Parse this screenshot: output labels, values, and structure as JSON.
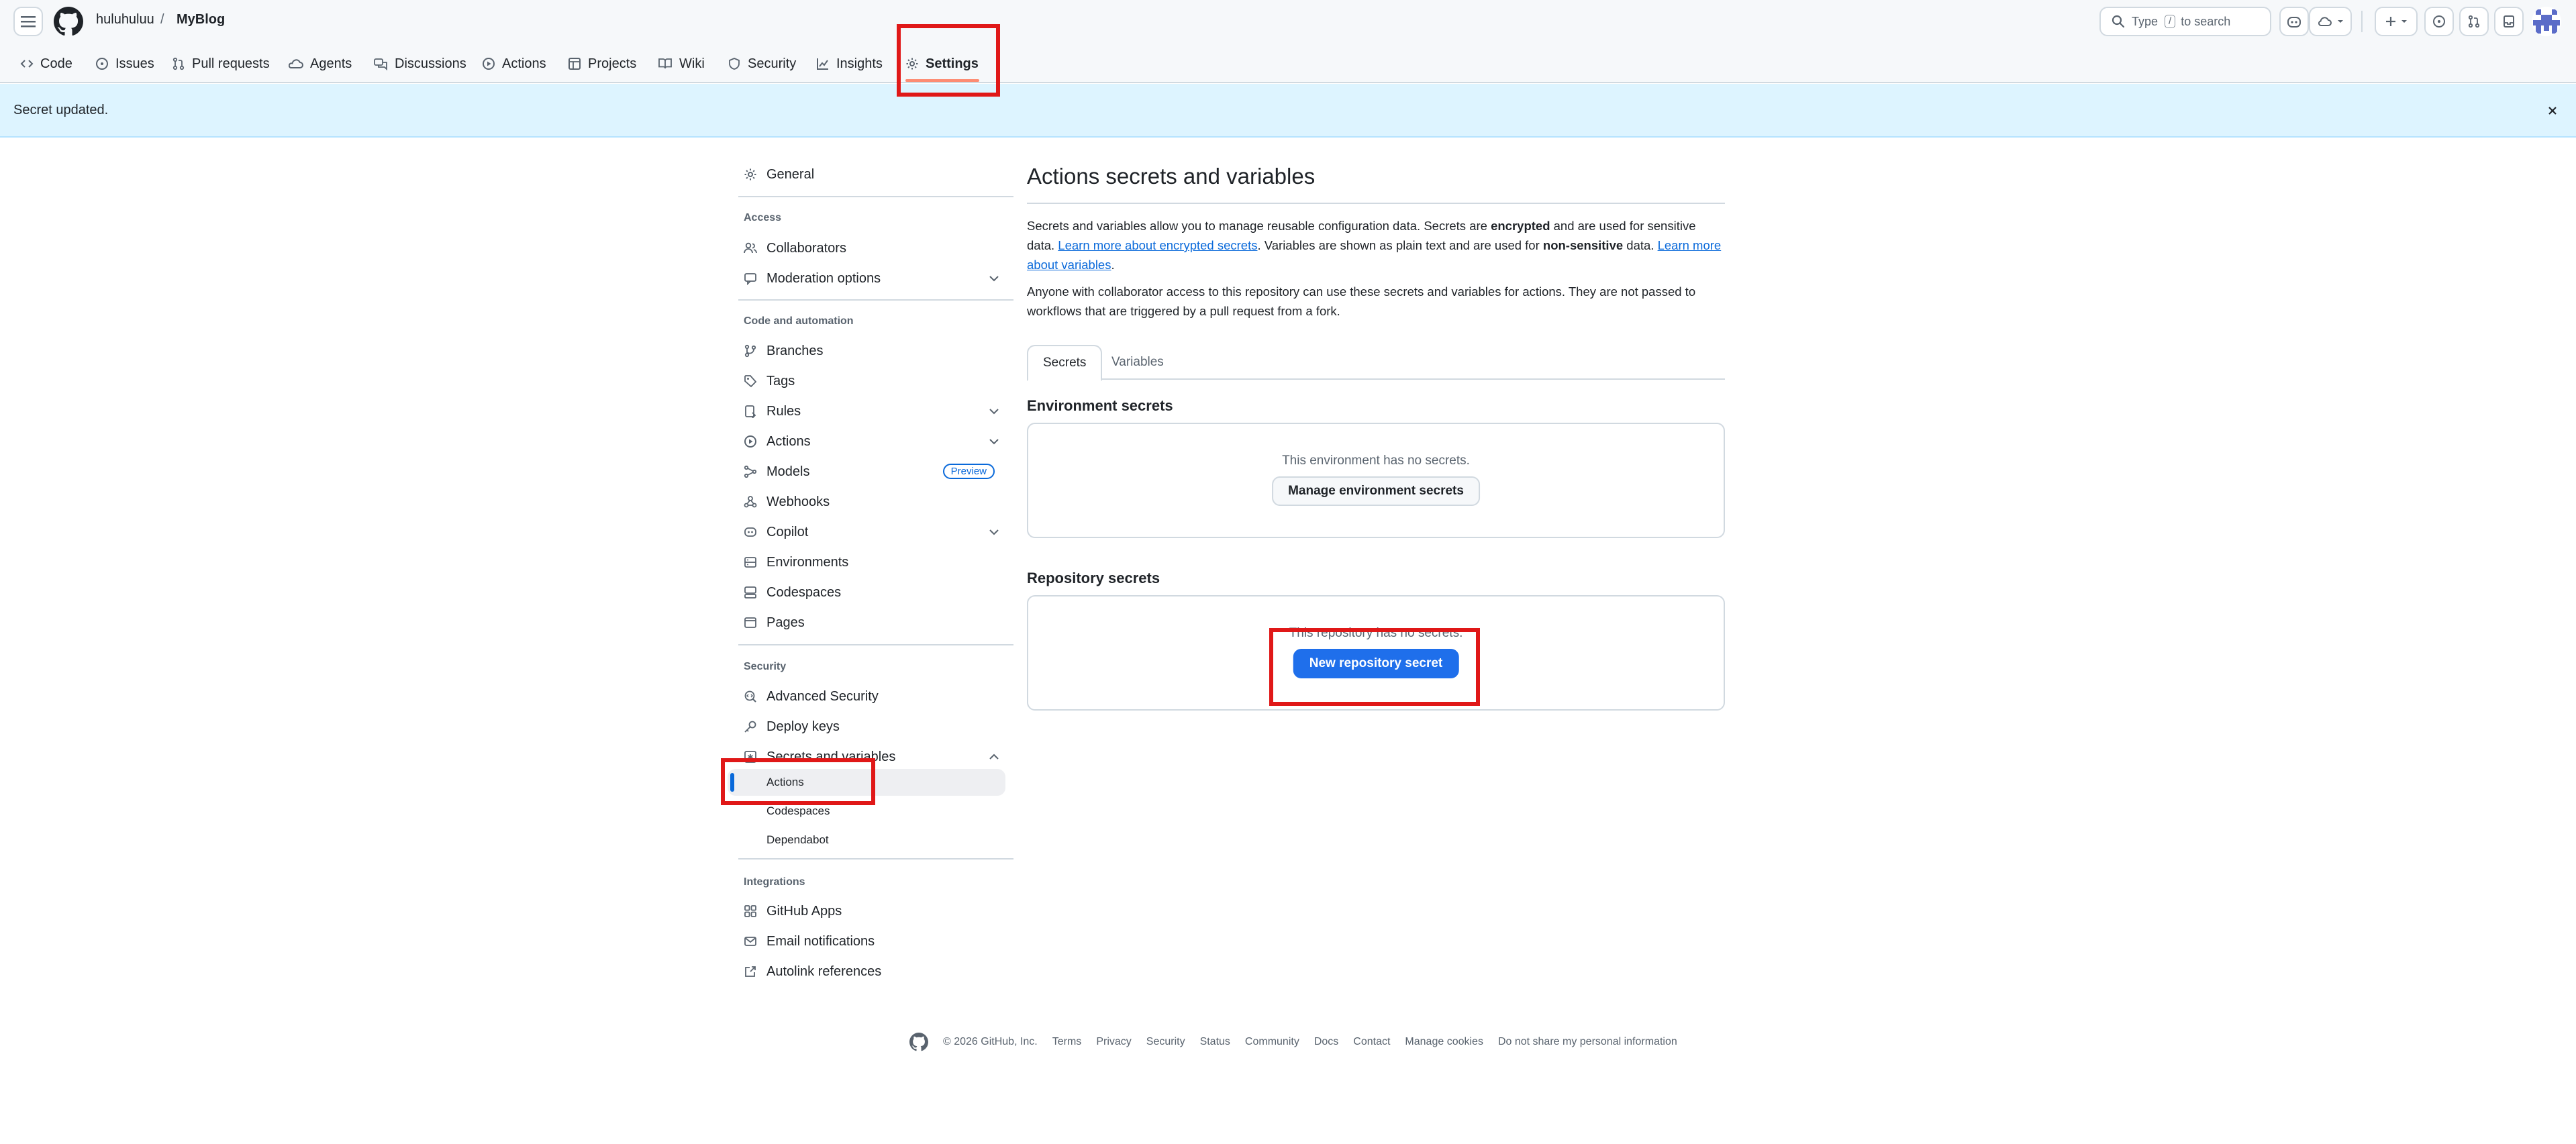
{
  "header": {
    "owner": "huluhuluu",
    "separator": "/",
    "repo": "MyBlog",
    "search_placeholder_pre": "Type",
    "search_key": "/",
    "search_placeholder_post": "to search"
  },
  "tabs": [
    {
      "label": "Code",
      "icon": "code-icon"
    },
    {
      "label": "Issues",
      "icon": "issue-icon"
    },
    {
      "label": "Pull requests",
      "icon": "pull-request-icon"
    },
    {
      "label": "Agents",
      "icon": "agent-icon"
    },
    {
      "label": "Discussions",
      "icon": "discussion-icon"
    },
    {
      "label": "Actions",
      "icon": "play-icon"
    },
    {
      "label": "Projects",
      "icon": "table-icon"
    },
    {
      "label": "Wiki",
      "icon": "book-icon"
    },
    {
      "label": "Security",
      "icon": "shield-icon"
    },
    {
      "label": "Insights",
      "icon": "graph-icon"
    },
    {
      "label": "Settings",
      "icon": "gear-icon",
      "active": true
    }
  ],
  "flash": {
    "message": "Secret updated."
  },
  "sidebar": {
    "general": "General",
    "access_heading": "Access",
    "collaborators": "Collaborators",
    "moderation": "Moderation options",
    "code_heading": "Code and automation",
    "branches": "Branches",
    "tags": "Tags",
    "rules": "Rules",
    "actions": "Actions",
    "models": "Models",
    "models_badge": "Preview",
    "webhooks": "Webhooks",
    "copilot": "Copilot",
    "environments": "Environments",
    "codespaces": "Codespaces",
    "pages": "Pages",
    "security_heading": "Security",
    "advanced_security": "Advanced Security",
    "deploy_keys": "Deploy keys",
    "secrets": "Secrets and variables",
    "sub_actions": "Actions",
    "sub_codespaces": "Codespaces",
    "sub_dependabot": "Dependabot",
    "integrations_heading": "Integrations",
    "github_apps": "GitHub Apps",
    "email_notifications": "Email notifications",
    "autolink": "Autolink references"
  },
  "main": {
    "title": "Actions secrets and variables",
    "p1_a": "Secrets and variables allow you to manage reusable configuration data. Secrets are ",
    "p1_b": "encrypted",
    "p1_c": " and are used for sensitive data. ",
    "p1_link1": "Learn more about encrypted secrets",
    "p1_d": ". Variables are shown as plain text and are used for ",
    "p1_e": "non-sensitive",
    "p1_f": " data. ",
    "p1_link2": "Learn more about variables",
    "p1_g": ".",
    "p2": "Anyone with collaborator access to this repository can use these secrets and variables for actions. They are not passed to workflows that are triggered by a pull request from a fork.",
    "tab_secrets": "Secrets",
    "tab_variables": "Variables",
    "env_title": "Environment secrets",
    "env_empty": "This environment has no secrets.",
    "env_button": "Manage environment secrets",
    "repo_title": "Repository secrets",
    "repo_empty": "This repository has no secrets.",
    "repo_button": "New repository secret"
  },
  "footer": {
    "copyright": "© 2026 GitHub, Inc.",
    "links": [
      "Terms",
      "Privacy",
      "Security",
      "Status",
      "Community",
      "Docs",
      "Contact",
      "Manage cookies",
      "Do not share my personal information"
    ]
  },
  "colors": {
    "accent": "#0969da",
    "primary_button": "#1f6feb",
    "flash_bg": "#ddf4ff",
    "highlight": "#e01818"
  }
}
